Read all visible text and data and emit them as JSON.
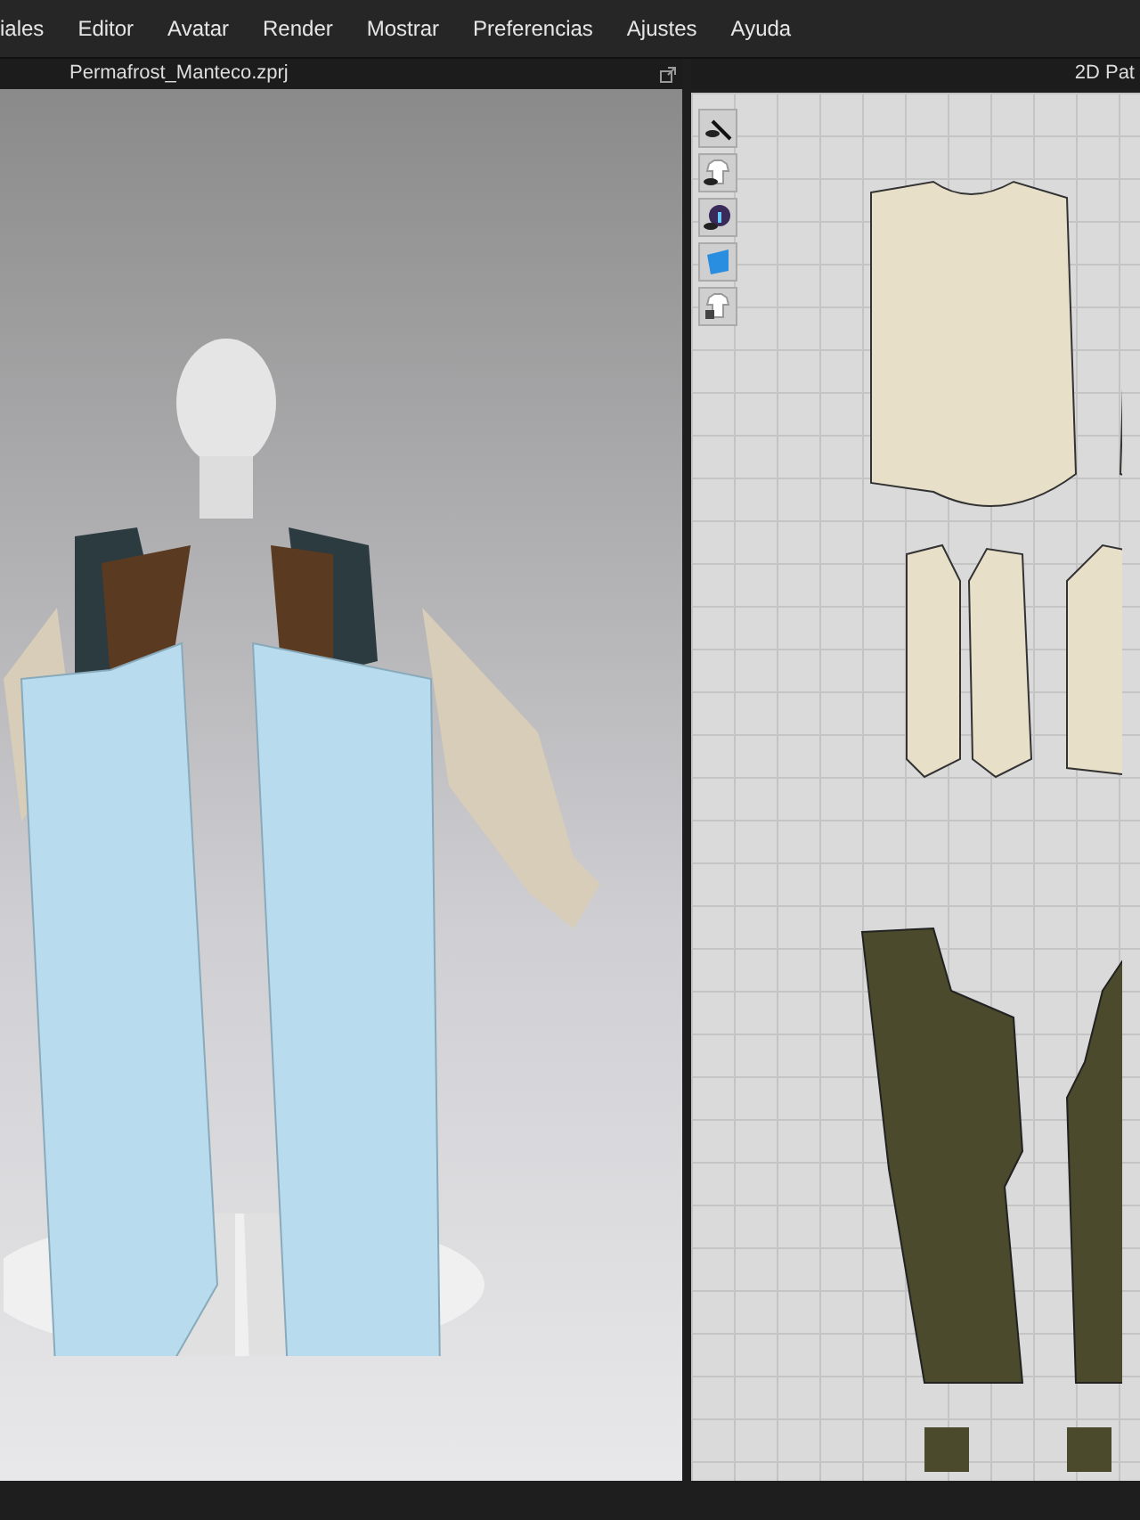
{
  "menu_bar": {
    "items": [
      "iales",
      "Editor",
      "Avatar",
      "Render",
      "Mostrar",
      "Preferencias",
      "Ajustes",
      "Ayuda"
    ]
  },
  "viewport_3d": {
    "title": "Permafrost_Manteco.zprj"
  },
  "pattern_window_2d": {
    "title": "2D Pat"
  }
}
